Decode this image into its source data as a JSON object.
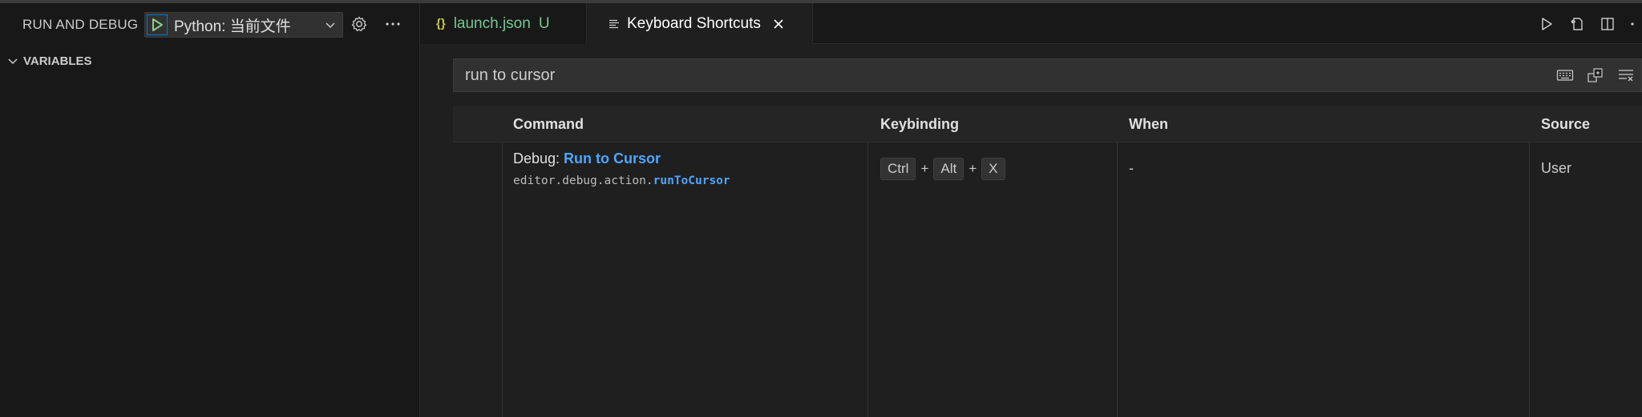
{
  "sidebar": {
    "title": "RUN AND DEBUG",
    "config_name": "Python: 当前文件",
    "section_variables": "VARIABLES"
  },
  "tabs": [
    {
      "label": "launch.json",
      "badge": "U",
      "icon": "json-braces-icon"
    },
    {
      "label": "Keyboard Shortcuts",
      "icon": "keyboard-shortcuts-icon"
    }
  ],
  "json_icon_text": "{}",
  "search": {
    "value": "run to cursor"
  },
  "table": {
    "headers": {
      "command": "Command",
      "keybinding": "Keybinding",
      "when": "When",
      "source": "Source"
    },
    "rows": [
      {
        "title_prefix": "Debug: ",
        "title_match": "Run to Cursor",
        "id_prefix": "editor.debug.action.",
        "id_match": "runToCursor",
        "keys": [
          "Ctrl",
          "Alt",
          "X"
        ],
        "plus": "+",
        "when": "-",
        "source": "User"
      }
    ]
  },
  "colors": {
    "accent": "#0078d4",
    "match_highlight": "#4fa6ff",
    "untracked_file": "#73c991",
    "play_green": "#89d185"
  }
}
